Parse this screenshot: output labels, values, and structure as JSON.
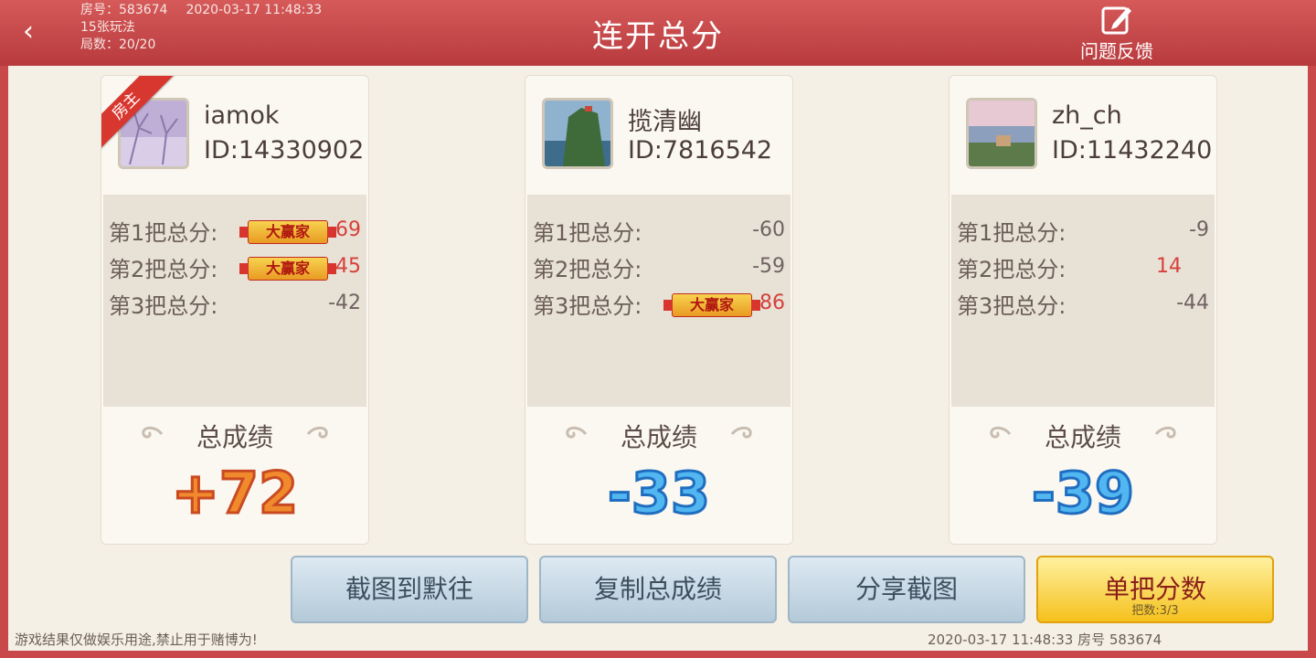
{
  "header": {
    "back_icon": "chevron-left-icon",
    "room_label": "房号：",
    "room_number": "583674",
    "datetime": "2020-03-17 11:48:33",
    "mode": "15张玩法",
    "rounds": "局数：20/20",
    "title": "连开总分",
    "feedback_label": "问题反馈",
    "feedback_icon": "edit-icon"
  },
  "players": [
    {
      "name": "iamok",
      "id": "ID:14330902",
      "host_label": "房主",
      "scores": [
        {
          "label": "第1把总分:",
          "value": "69",
          "winner": true
        },
        {
          "label": "第2把总分:",
          "value": "45",
          "winner": true
        },
        {
          "label": "第3把总分:",
          "value": "-42",
          "winner": false
        }
      ],
      "total_label": "总成绩",
      "total": "+72"
    },
    {
      "name": "揽清幽",
      "id": "ID:7816542",
      "scores": [
        {
          "label": "第1把总分:",
          "value": "-60",
          "winner": false
        },
        {
          "label": "第2把总分:",
          "value": "-59",
          "winner": false
        },
        {
          "label": "第3把总分:",
          "value": "86",
          "winner": true
        }
      ],
      "total_label": "总成绩",
      "total": "-33"
    },
    {
      "name": "zh_ch",
      "id": "ID:11432240",
      "scores": [
        {
          "label": "第1把总分:",
          "value": "-9",
          "winner": false
        },
        {
          "label": "第2把总分:",
          "value": "14",
          "winner": false
        },
        {
          "label": "第3把总分:",
          "value": "-44",
          "winner": false
        }
      ],
      "total_label": "总成绩",
      "total": "-39"
    }
  ],
  "winner_badge_label": "大赢家",
  "buttons": {
    "screenshot_to_moiwang": "截图到默往",
    "copy_total": "复制总成绩",
    "share_screenshot": "分享截图",
    "single_round": "单把分数",
    "single_round_sub": "把数:3/3"
  },
  "footer": {
    "disclaimer": "游戏结果仅做娱乐用途,禁止用于赌博为!",
    "stamp": "2020-03-17 11:48:33 房号 583674"
  },
  "colors": {
    "header_red": "#c9484a",
    "positive": "#d6403b",
    "total_positive": "#f08a2c",
    "total_negative": "#52b6f0",
    "gold_button": "#f5c11c"
  }
}
